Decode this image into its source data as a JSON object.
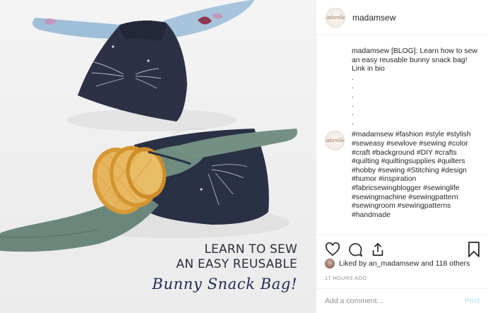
{
  "photo": {
    "caption_line1": "LEARN TO SEW",
    "caption_line2": "AN EASY REUSABLE",
    "caption_line3": "Bunny Snack Bag!"
  },
  "header": {
    "avatar_text": "MadamSew",
    "username": "madamsew"
  },
  "comments": [
    {
      "text_lines": [
        "madamsew [BLOG]: Learn how to sew an easy reusable bunny snack bag!",
        "Link in bio"
      ],
      "dots": [
        ".",
        ".",
        ".",
        ".",
        ".",
        "."
      ]
    },
    {
      "tags": "#madamsew #fashion #style #stylish #seweasy #sewlove #sewing #color #craft #background #DIY #crafts #quilting #quiltingsupplies #quilters #hobby #sewing #Stitching #design #humor #inspiration #fabricsewingblogger #sewinglife #sewingmachine #sewingpattern #sewingroom #sewingpatterns #handmade"
    }
  ],
  "actions": {
    "like_icon": "heart-icon",
    "comment_icon": "comment-icon",
    "share_icon": "share-icon",
    "save_icon": "bookmark-icon"
  },
  "likes": {
    "text": "Liked by an_madamsew and 118 others"
  },
  "timestamp": "17 HOURS AGO",
  "add_comment": {
    "placeholder": "Add a comment...",
    "post_label": "Post"
  }
}
